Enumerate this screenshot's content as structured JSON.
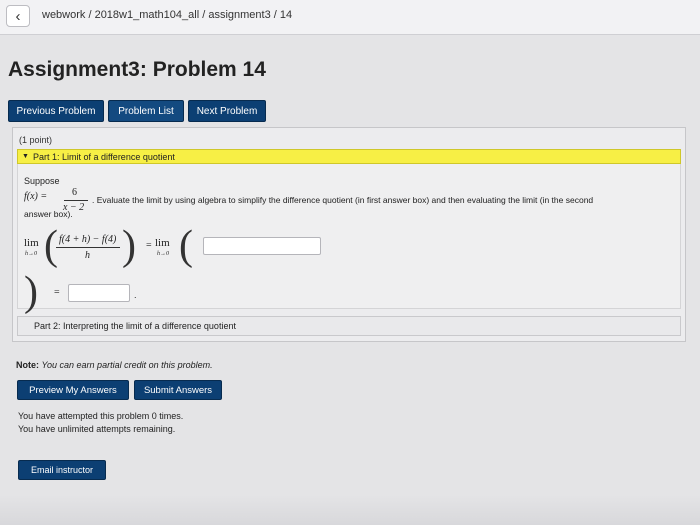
{
  "breadcrumb": "webwork / 2018w1_math104_all / assignment3 / 14",
  "page_title": "Assignment3: Problem 14",
  "nav": {
    "previous": "Previous Problem",
    "list": "Problem List",
    "next": "Next Problem"
  },
  "problem": {
    "points": "(1 point)",
    "part1_title": "Part 1: Limit of a difference quotient",
    "suppose": "Suppose",
    "fx_lhs": "f(x) =",
    "fx_num": "6",
    "fx_den": "x − 2",
    "instructions": ". Evaluate the limit by using algebra to simplify the difference quotient (in first answer box) and then evaluating the limit (in the second",
    "instructions_cont": "answer box).",
    "lim": "lim",
    "lim_sub": "h→0",
    "dq_num": "f(4 + h) − f(4)",
    "dq_den": "h",
    "equals": "=",
    "answer1": "",
    "answer2": "",
    "period": ".",
    "part2_title": "Part 2: Interpreting the limit of a difference quotient"
  },
  "note_label": "Note:",
  "note_text": "You can earn partial credit on this problem.",
  "buttons": {
    "preview": "Preview My Answers",
    "submit": "Submit Answers",
    "email": "Email instructor"
  },
  "attempts": {
    "line1": "You have attempted this problem 0 times.",
    "line2": "You have unlimited attempts remaining."
  }
}
